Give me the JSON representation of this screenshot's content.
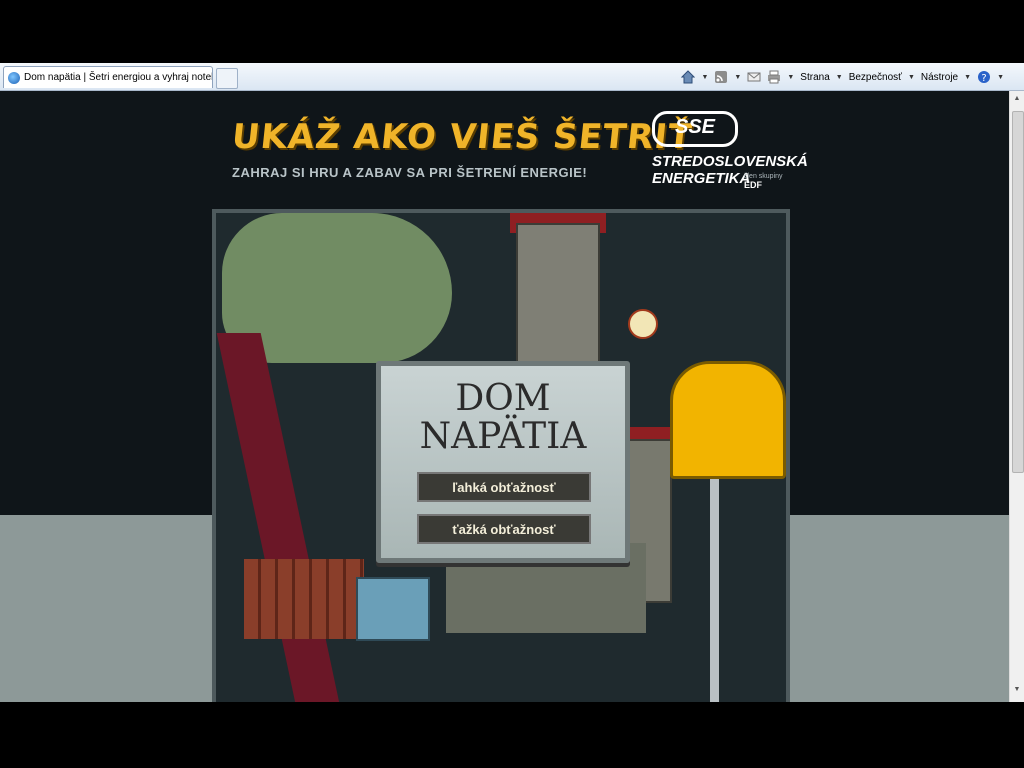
{
  "browser": {
    "tab_title": "Dom napätia | Šetri energiou a vyhraj notebook!",
    "commands": [
      {
        "label": "Strana"
      },
      {
        "label": "Bezpečnosť"
      },
      {
        "label": "Nástroje"
      }
    ],
    "icons": {
      "home": "home-icon",
      "feeds": "feeds-icon",
      "mail": "mail-icon",
      "print": "print-icon",
      "help": "help-icon"
    }
  },
  "page": {
    "headline": "UKÁŽ AKO VIEŠ ŠETRIŤ",
    "subline": "ZAHRAJ SI HRU A ZABAV SA PRI ŠETRENÍ ENERGIE!",
    "logo": {
      "mark": "SSE",
      "name_line1": "STREDOSLOVENSKÁ",
      "name_line2": "ENERGETIKA",
      "edf_text": "člen skupiny",
      "edf_logo": "EDF"
    }
  },
  "game": {
    "title_line1": "DOM",
    "title_line2": "NAPÄTIA",
    "easy_button": "ľahká obťažnosť",
    "hard_button": "ťažká obťažnosť"
  },
  "colors": {
    "headline": "#f0b429",
    "mailbox": "#f2b400",
    "tree_trunk": "#6b1727",
    "roof": "#8f1f22"
  }
}
